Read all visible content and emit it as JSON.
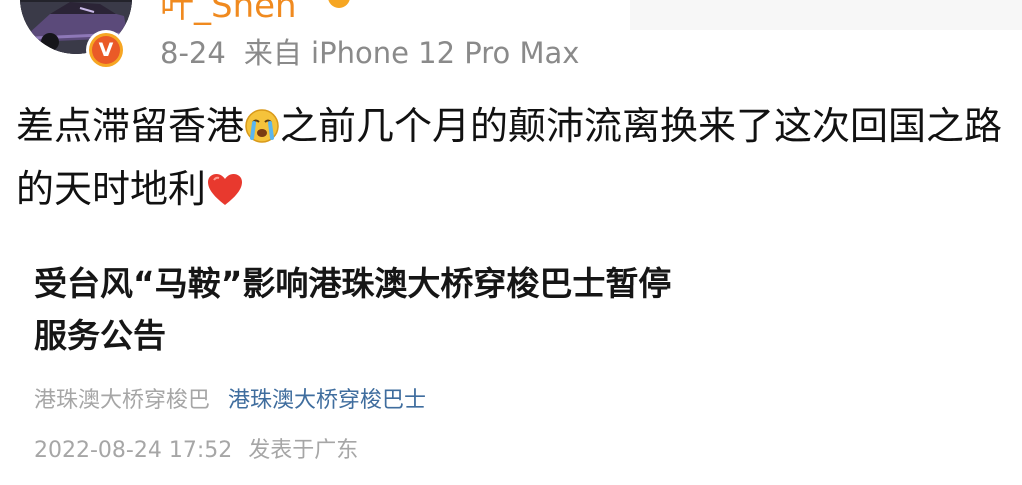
{
  "author": {
    "name": "叶_Shen",
    "avatar_icon": "car-avatar",
    "verified_badge": "V"
  },
  "post": {
    "date": "8-24",
    "source": "来自 iPhone 12 Pro Max",
    "text_part1": "差点滞留香港",
    "emoji_1": "crying-face-emoji",
    "text_part2": "之前几个月的颠沛流离换来了这次回国之路的天时地利",
    "emoji_2": "red-heart-emoji"
  },
  "article_card": {
    "title": "受台风“马鞍”影响港珠澳大桥穿梭巴士暂停服务公告",
    "source_name": "港珠澳大桥穿梭巴",
    "source_link": "港珠澳大桥穿梭巴士",
    "published_at": "2022-08-24 17:52",
    "published_location": "发表于广东"
  },
  "colors": {
    "username": "#f08a1f",
    "meta_gray": "#8a8a8a",
    "link_blue": "#3f6d9e",
    "badge_orange": "#ea5a27",
    "heart_red": "#e8392e"
  }
}
